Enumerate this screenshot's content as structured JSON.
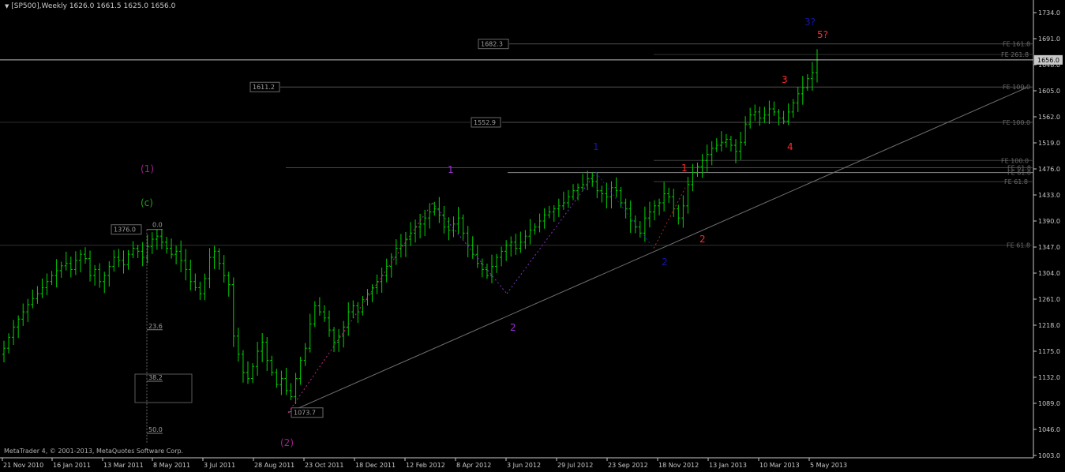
{
  "header": {
    "title": "[SP500],Weekly  1626.0 1661.5 1625.0 1656.0"
  },
  "footer": {
    "copyright": "MetaTrader 4, © 2001-2013, MetaQuotes Software Corp."
  },
  "colors": {
    "bar": "#00d400",
    "axis": "#c8c8c8",
    "grid": "#3a3a3a",
    "price_line": "#c0c0c0",
    "red": "#ff2a2a",
    "purple": "#9a2fd0",
    "blue": "#1515b0",
    "green": "#1ea01e",
    "magenta": "#a0208a"
  },
  "chart_data": {
    "type": "bar",
    "symbol": "SP500",
    "timeframe": "Weekly",
    "ohlc_last": {
      "open": 1626.0,
      "high": 1661.5,
      "low": 1625.0,
      "close": 1656.0
    },
    "ylim": [
      1003.0,
      1755.0
    ],
    "y_ticks": [
      "1734.0",
      "1691.0",
      "1648.0",
      "1605.0",
      "1562.0",
      "1519.0",
      "1476.0",
      "1433.0",
      "1390.0",
      "1347.0",
      "1304.0",
      "1261.0",
      "1218.0",
      "1175.0",
      "1132.0",
      "1089.0",
      "1046.0",
      "1003.0"
    ],
    "x_ticks": [
      "21 Nov 2010",
      "16 Jan 2011",
      "13 Mar 2011",
      "8 May 2011",
      "3 Jul 2011",
      "28 Aug 2011",
      "23 Oct 2011",
      "18 Dec 2011",
      "12 Feb 2012",
      "8 Apr 2012",
      "3 Jun 2012",
      "29 Jul 2012",
      "23 Sep 2012",
      "18 Nov 2012",
      "13 Jan 2013",
      "10 Mar 2013",
      "5 May 2013"
    ],
    "current_price": "1656.0",
    "price_close_series": [
      1180,
      1198,
      1215,
      1228,
      1240,
      1252,
      1262,
      1270,
      1280,
      1290,
      1300,
      1308,
      1316,
      1320,
      1310,
      1325,
      1335,
      1328,
      1300,
      1310,
      1290,
      1300,
      1315,
      1330,
      1325,
      1318,
      1335,
      1345,
      1340,
      1330,
      1348,
      1360,
      1365,
      1355,
      1345,
      1335,
      1340,
      1325,
      1310,
      1290,
      1280,
      1270,
      1295,
      1330,
      1340,
      1320,
      1300,
      1285,
      1200,
      1170,
      1140,
      1130,
      1150,
      1175,
      1190,
      1160,
      1140,
      1120,
      1130,
      1110,
      1100,
      1130,
      1160,
      1180,
      1220,
      1250,
      1240,
      1230,
      1210,
      1190,
      1200,
      1215,
      1240,
      1250,
      1240,
      1260,
      1270,
      1280,
      1290,
      1300,
      1315,
      1330,
      1345,
      1350,
      1360,
      1370,
      1380,
      1385,
      1395,
      1405,
      1410,
      1400,
      1380,
      1375,
      1385,
      1395,
      1370,
      1350,
      1335,
      1320,
      1310,
      1300,
      1315,
      1330,
      1340,
      1350,
      1355,
      1345,
      1355,
      1365,
      1375,
      1380,
      1390,
      1400,
      1405,
      1410,
      1415,
      1420,
      1430,
      1440,
      1445,
      1450,
      1460,
      1455,
      1440,
      1435,
      1430,
      1445,
      1440,
      1420,
      1410,
      1390,
      1380,
      1370,
      1395,
      1405,
      1415,
      1420,
      1435,
      1430,
      1410,
      1395,
      1415,
      1450,
      1470,
      1480,
      1490,
      1500,
      1510,
      1515,
      1520,
      1525,
      1515,
      1505,
      1520,
      1550,
      1565,
      1570,
      1560,
      1565,
      1575,
      1570,
      1560,
      1555,
      1570,
      1585,
      1600,
      1610,
      1625,
      1635,
      1656
    ],
    "levels": [
      {
        "label": "1682.3",
        "value": 1682.3
      },
      {
        "label": "1611.2",
        "value": 1611.2
      },
      {
        "label": "1552.9",
        "value": 1552.9
      },
      {
        "label": "1376.0",
        "value": 1376.0
      },
      {
        "label": "1073.7",
        "value": 1073.7
      }
    ],
    "fe_labels": [
      {
        "label": "FE 161.8",
        "value": 1682.3
      },
      {
        "label": "FE 261.8",
        "value": 1665.0
      },
      {
        "label": "FE 100.0",
        "value": 1611.2
      },
      {
        "label": "FE 100.0",
        "value": 1552.9
      },
      {
        "label": "FE 100.0",
        "value": 1490.0
      },
      {
        "label": "FE 61.8",
        "value": 1478.0
      },
      {
        "label": "FE 61.8",
        "value": 1470.0
      },
      {
        "label": "FE 61.8",
        "value": 1455.0
      },
      {
        "label": "FE 61.8",
        "value": 1350.0
      }
    ],
    "fib_retracement": [
      {
        "label": "0.0",
        "value": 1376.0
      },
      {
        "label": "23.6",
        "value": 1217.0
      },
      {
        "label": "38.2",
        "value": 1132.0
      },
      {
        "label": "50.0",
        "value": 1046.0
      }
    ],
    "wave_labels": [
      {
        "text": "(1)",
        "color": "magenta"
      },
      {
        "text": "(c)",
        "color": "green"
      },
      {
        "text": "(2)",
        "color": "magenta"
      },
      {
        "text": "1",
        "color": "purple"
      },
      {
        "text": "2",
        "color": "purple"
      },
      {
        "text": "1",
        "color": "blue"
      },
      {
        "text": "2",
        "color": "blue"
      },
      {
        "text": "3?",
        "color": "blue"
      },
      {
        "text": "1",
        "color": "red"
      },
      {
        "text": "2",
        "color": "red"
      },
      {
        "text": "3",
        "color": "red"
      },
      {
        "text": "4",
        "color": "red"
      },
      {
        "text": "5?",
        "color": "red"
      }
    ]
  }
}
